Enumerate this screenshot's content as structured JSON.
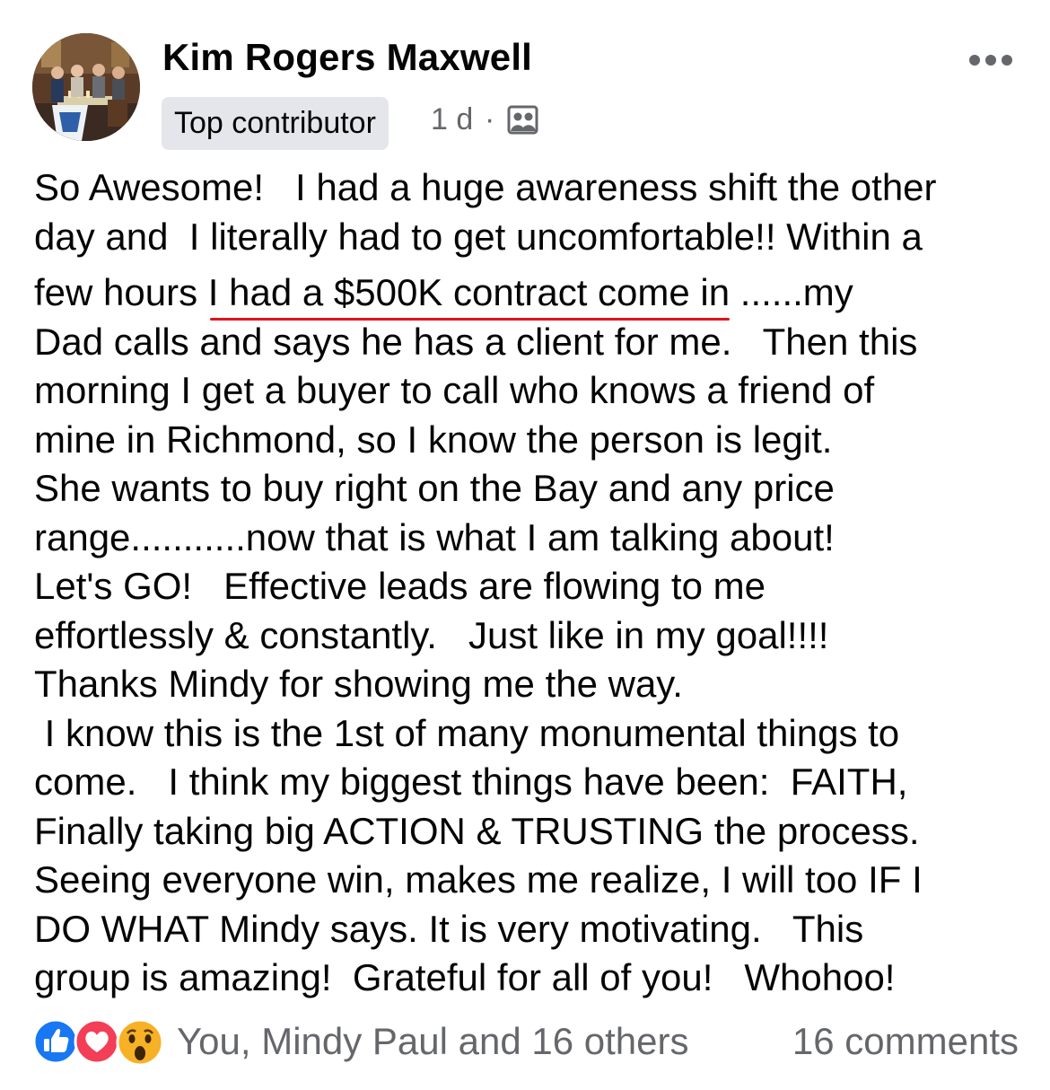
{
  "post": {
    "author": "Kim Rogers Maxwell",
    "badge": "Top contributor",
    "time": "1 d",
    "separator": "·",
    "audience_icon": "group-icon",
    "lines": [
      "So Awesome!   I had a huge awareness shift the other",
      "day and  I literally had to get uncomfortable!! Within a",
      "few hours ",
      "I had a $500K contract come in",
      " ......my",
      "Dad calls and says he has a client for me.   Then this",
      "morning I get a buyer to call who knows a friend of",
      "mine in Richmond, so I know the person is legit.",
      "She wants to buy right on the Bay and any price",
      "range...........now that is what I am talking about!",
      "Let's GO!   Effective leads are flowing to me",
      "effortlessly & constantly.   Just like in my goal!!!!",
      "Thanks Mindy for showing me the way.",
      " I know this is the 1st of many monumental things to",
      "come.   I think my biggest things have been:  FAITH,",
      "Finally taking big ACTION & TRUSTING the process.",
      "Seeing everyone win, makes me realize, I will too IF I",
      "DO WHAT Mindy says. It is very motivating.   This",
      "group is amazing!  Grateful for all of you!   Whohoo!"
    ]
  },
  "footer": {
    "reaction_icons": [
      "like-icon",
      "love-icon",
      "wow-icon"
    ],
    "reactions_text": "You, Mindy Paul and 16 others",
    "comments_text": "16 comments"
  },
  "colors": {
    "text": "#050505",
    "secondary": "#65676b",
    "badge_bg": "#e4e6eb",
    "underline": "#e0141e",
    "like_blue": "#1877f2",
    "love_red": "#f33e58",
    "wow_yellow": "#f7b125"
  }
}
